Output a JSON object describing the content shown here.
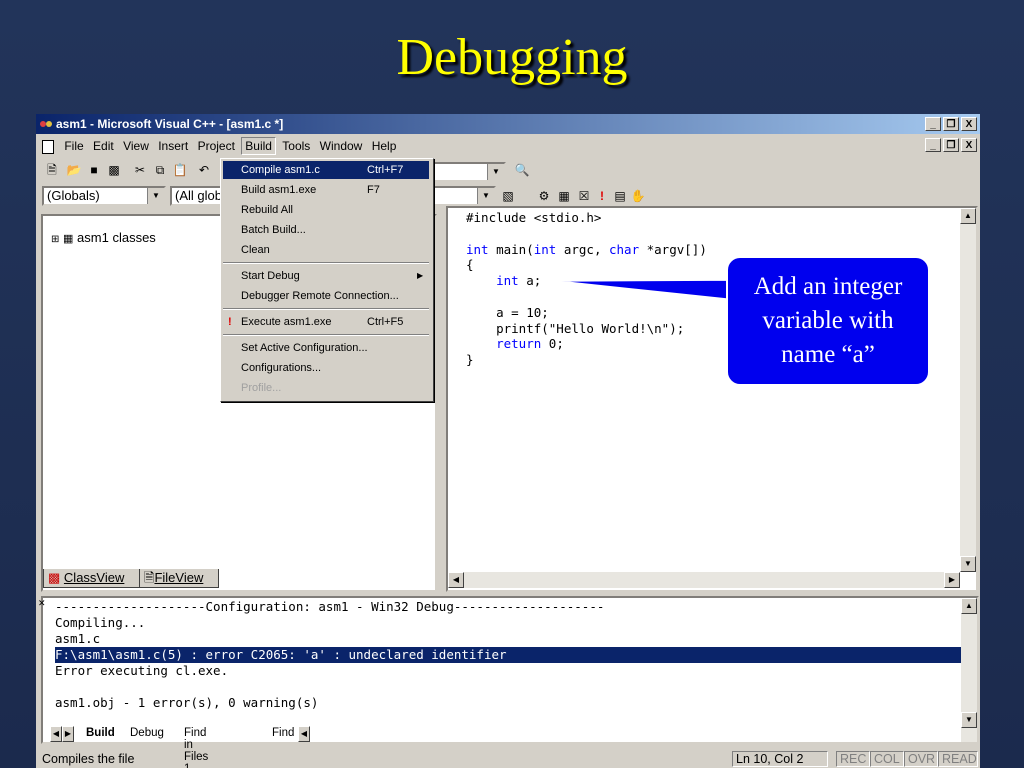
{
  "slide": {
    "title": "Debugging"
  },
  "window": {
    "title": "asm1 - Microsoft Visual C++ - [asm1.c *]",
    "controls": [
      "_",
      "❐",
      "X"
    ]
  },
  "menubar": {
    "items": [
      "File",
      "Edit",
      "View",
      "Insert",
      "Project",
      "Build",
      "Tools",
      "Window",
      "Help"
    ]
  },
  "toolbar": {
    "globals_combo": "(Globals)",
    "members_combo": "(All glob"
  },
  "build_menu": {
    "items": [
      {
        "label": "Compile asm1.c",
        "shortcut": "Ctrl+F7"
      },
      {
        "label": "Build asm1.exe",
        "shortcut": "F7"
      },
      {
        "label": "Rebuild All",
        "shortcut": ""
      },
      {
        "label": "Batch Build...",
        "shortcut": ""
      },
      {
        "label": "Clean",
        "shortcut": ""
      },
      {
        "label": "Start Debug",
        "shortcut": ""
      },
      {
        "label": "Debugger Remote Connection...",
        "shortcut": ""
      },
      {
        "label": "Execute asm1.exe",
        "shortcut": "Ctrl+F5"
      },
      {
        "label": "Set Active Configuration...",
        "shortcut": ""
      },
      {
        "label": "Configurations...",
        "shortcut": ""
      },
      {
        "label": "Profile...",
        "shortcut": ""
      }
    ]
  },
  "workspace": {
    "tree_root": "asm1 classes",
    "tabs": [
      "ClassView",
      "FileView"
    ]
  },
  "editor": {
    "lines": [
      "#include <stdio.h>",
      "",
      "int main(int argc, char *argv[])",
      "{",
      "    int a;",
      "",
      "    a = 10;",
      "    printf(\"Hello World!\\n\");",
      "    return 0;",
      "}"
    ]
  },
  "output": {
    "lines": [
      "--------------------Configuration: asm1 - Win32 Debug--------------------",
      "Compiling...",
      "asm1.c",
      "F:\\asm1\\asm1.c(5) : error C2065: 'a' : undeclared identifier",
      "Error executing cl.exe.",
      "",
      "asm1.obj - 1 error(s), 0 warning(s)"
    ],
    "tabs": [
      "Build",
      "Debug",
      "Find in Files 1",
      "Find"
    ]
  },
  "statusbar": {
    "message": "Compiles the file",
    "position": "Ln 10, Col 2",
    "indicators": [
      "REC",
      "COL",
      "OVR",
      "READ"
    ]
  },
  "callout": {
    "line1": "Add an integer",
    "line2": "variable with",
    "line3": "name “a”"
  },
  "colors": {
    "slide_bg": "#1b2a4d",
    "title": "#ffff00",
    "titlebar": "#0a246a",
    "callout": "#0000ee",
    "keyword": "#0000ff"
  }
}
